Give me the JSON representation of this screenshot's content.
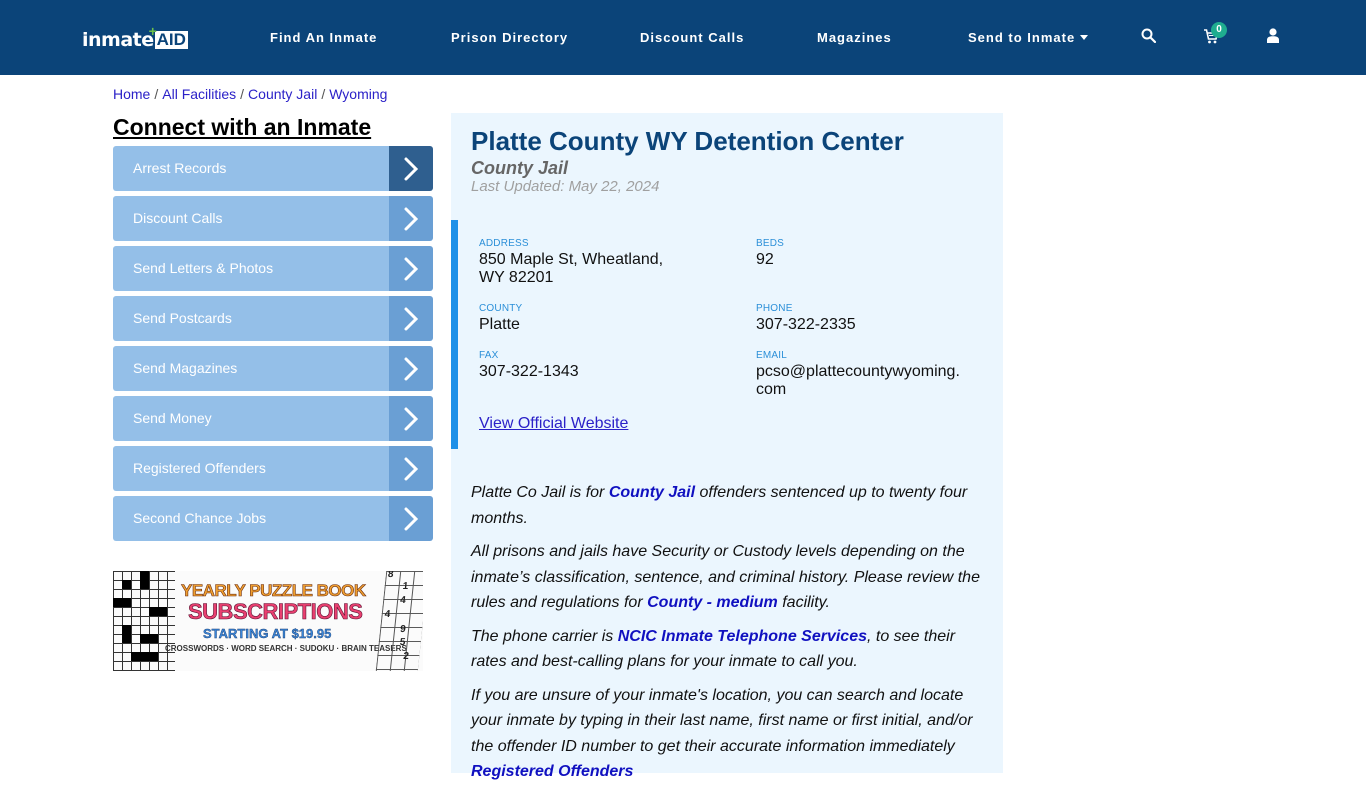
{
  "header": {
    "logo": {
      "part1": "inmate",
      "part2": "AID",
      "plus": "+"
    },
    "nav": [
      {
        "label": "Find An Inmate"
      },
      {
        "label": "Prison Directory"
      },
      {
        "label": "Discount Calls"
      },
      {
        "label": "Magazines"
      },
      {
        "label": "Send to Inmate",
        "has_dropdown": true
      }
    ],
    "icons": {
      "search": "search-icon",
      "cart": "cart-icon",
      "user": "user-icon"
    },
    "cart_count": "0",
    "colors": {
      "navbar": "#0b4479",
      "badge": "#1fad8f"
    }
  },
  "breadcrumb": {
    "items": [
      "Home",
      "All Facilities",
      "County Jail",
      "Wyoming"
    ],
    "separator": "/"
  },
  "sidebar": {
    "title": "Connect with an Inmate",
    "items": [
      {
        "label": "Arrest Records"
      },
      {
        "label": "Discount Calls"
      },
      {
        "label": "Send Letters & Photos"
      },
      {
        "label": "Send Postcards"
      },
      {
        "label": "Send Magazines"
      },
      {
        "label": "Send Money"
      },
      {
        "label": "Registered Offenders"
      },
      {
        "label": "Second Chance Jobs"
      }
    ],
    "ad": {
      "line1": "YEARLY PUZZLE BOOK",
      "line2": "SUBSCRIPTIONS",
      "line3": "STARTING AT $19.95",
      "line4": "CROSSWORDS · WORD SEARCH · SUDOKU · BRAIN TEASERS",
      "sudoku_digits": [
        "8",
        "1",
        "4",
        "4",
        "9",
        "5",
        "2"
      ]
    }
  },
  "facility": {
    "name": "Platte County WY Detention Center",
    "type": "County Jail",
    "last_updated": "Last Updated: May 22, 2024",
    "fields": {
      "address": {
        "label": "ADDRESS",
        "value_line1": "850 Maple St, Wheatland,",
        "value_line2": "WY 82201"
      },
      "beds": {
        "label": "BEDS",
        "value": "92"
      },
      "county": {
        "label": "COUNTY",
        "value": "Platte"
      },
      "phone": {
        "label": "PHONE",
        "value": "307-322-2335"
      },
      "fax": {
        "label": "FAX",
        "value": "307-322-1343"
      },
      "email": {
        "label": "EMAIL",
        "value_line1": "pcso@plattecountywyoming.",
        "value_line2": "com"
      }
    },
    "official_link": "View Official Website",
    "description": {
      "p1": {
        "before": "Platte Co Jail is for ",
        "link": "County Jail",
        "after": " offenders sentenced up to twenty four months."
      },
      "p2": {
        "before": "All prisons and jails have Security or Custody levels depending on the inmate’s classification, sentence, and criminal history. Please review the rules and regulations for ",
        "link": "County - medium",
        "after": " facility."
      },
      "p3": {
        "before": "The phone carrier is ",
        "link": "NCIC Inmate Telephone Services",
        "after": ", to see their rates and best-calling plans for your inmate to call you."
      },
      "p4": {
        "before": "If you are unsure of your inmate's location, you can search and locate your inmate by typing in their last name, first name or first initial, and/or the offender ID number to get their accurate information immediately ",
        "link": "Registered Offenders"
      }
    }
  }
}
